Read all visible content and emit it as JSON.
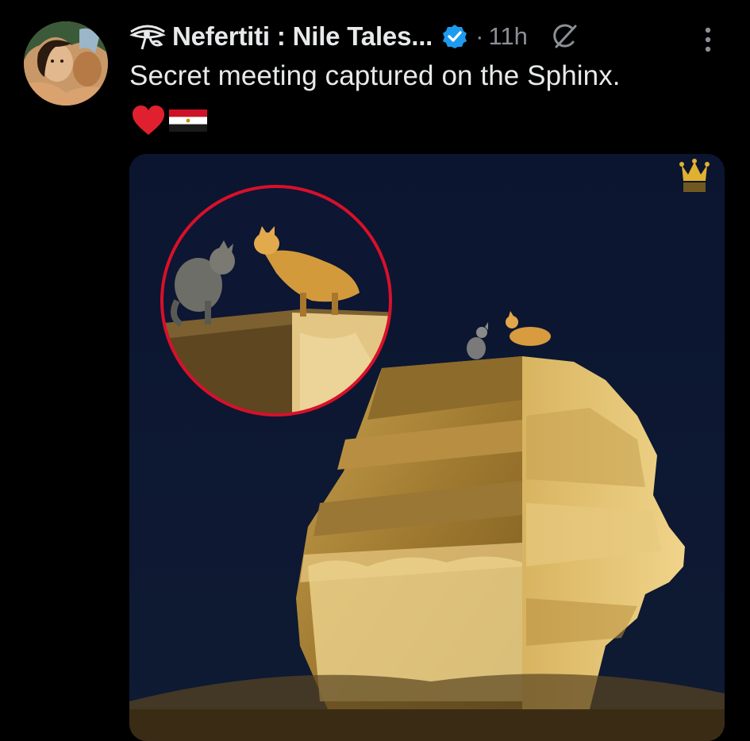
{
  "tweet": {
    "display_name": "Nefertiti : Nile Tales...",
    "separator": "·",
    "timestamp": "11h",
    "text": "Secret meeting captured on the Sphinx.",
    "emojis": [
      "heart",
      "egypt-flag"
    ],
    "verified": true,
    "media": {
      "type": "photo"
    }
  },
  "colors": {
    "background": "#000000",
    "text": "#e7e9ea",
    "secondary_text": "#8b9097",
    "verified": "#1d9bf0",
    "heart": "#e0202e",
    "circle_highlight": "#d8102a"
  },
  "icons": {
    "name_prefix": "eye-of-horus-icon",
    "verified": "verified-badge-icon",
    "grok": "grok-icon",
    "more": "more-options-icon",
    "media_watermark": "crown-icon"
  }
}
